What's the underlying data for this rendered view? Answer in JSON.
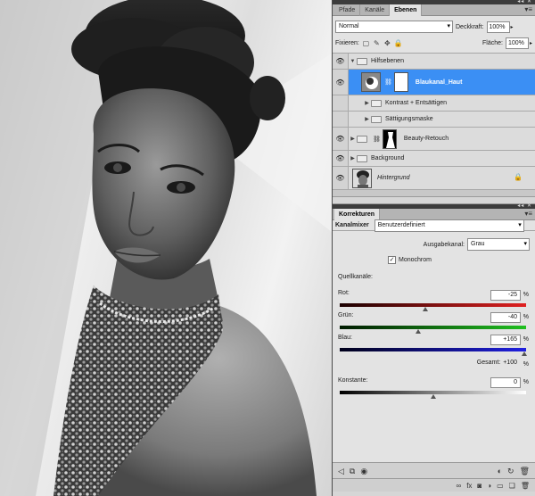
{
  "layers_panel": {
    "tabs": [
      "Pfade",
      "Kanäle",
      "Ebenen"
    ],
    "active_tab": "Ebenen",
    "blend_mode": "Normal",
    "opacity_label": "Deckkraft:",
    "opacity_value": "100%",
    "lock_label": "Fixieren:",
    "fill_label": "Fläche:",
    "fill_value": "100%",
    "layers": [
      {
        "name": "Hilfsebenen",
        "kind": "group-open",
        "visible": true
      },
      {
        "name": "Blaukanal_Haut",
        "kind": "adjustment",
        "visible": true,
        "selected": true
      },
      {
        "name": "Kontrast + Entsättigen",
        "kind": "group",
        "visible": false
      },
      {
        "name": "Sättigungsmaske",
        "kind": "group",
        "visible": false
      },
      {
        "name": "Beauty-Retouch",
        "kind": "group-mask",
        "visible": true
      },
      {
        "name": "Background",
        "kind": "group",
        "visible": true
      },
      {
        "name": "Hintergrund",
        "kind": "image",
        "visible": true,
        "locked": true
      }
    ]
  },
  "adjustments_panel": {
    "tab": "Korrekturen",
    "type_label": "Kanalmixer",
    "preset": "Benutzerdefiniert",
    "output_channel_label": "Ausgabekanal:",
    "output_channel": "Grau",
    "monochrome_label": "Monochrom",
    "monochrome_checked": true,
    "source_channels_label": "Quellkanäle:",
    "red_label": "Rot:",
    "red_value": "-25",
    "green_label": "Grün:",
    "green_value": "-40",
    "blue_label": "Blau:",
    "blue_value": "+165",
    "total_label": "Gesamt:",
    "total_value": "+100",
    "constant_label": "Konstante:",
    "constant_value": "0",
    "percent": "%"
  },
  "colors": {
    "selection": "#3b8ff4",
    "panel_bg": "#e3e3e3",
    "red_slider": "#e02020",
    "green_slider": "#20c020",
    "blue_slider": "#2020e0"
  }
}
